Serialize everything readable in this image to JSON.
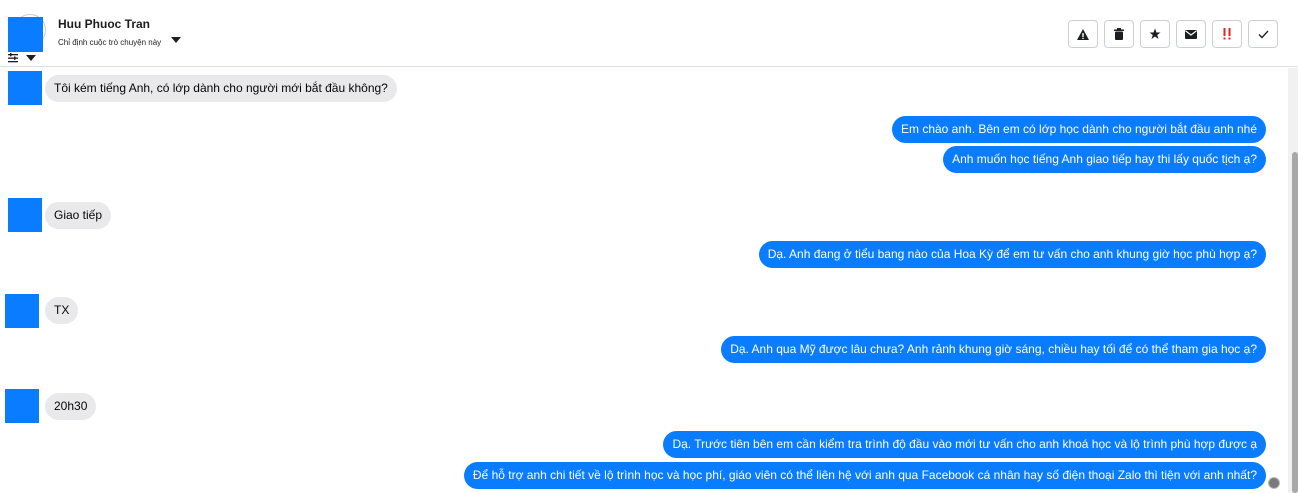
{
  "header": {
    "contact_name": "Huu Phuoc Tran",
    "assign_label": "Chỉ định cuộc trò chuyện này",
    "actions": [
      {
        "icon": "warning-icon"
      },
      {
        "icon": "trash-icon"
      },
      {
        "icon": "star-icon"
      },
      {
        "icon": "envelope-icon"
      },
      {
        "icon": "spam-icon",
        "color": "#e02424"
      },
      {
        "icon": "check-icon"
      }
    ]
  },
  "messages": [
    {
      "side": "in",
      "text": "Tôi kém tiếng Anh, có lớp dành cho người mới bắt đầu không?"
    },
    {
      "side": "out",
      "text": "Em chào anh. Bên em có lớp học dành cho người bắt đầu anh nhé"
    },
    {
      "side": "out",
      "text": "Anh muốn học tiếng Anh giao tiếp hay thi lấy quốc tịch ạ?"
    },
    {
      "side": "in",
      "text": "Giao tiếp"
    },
    {
      "side": "out",
      "text": "Dạ. Anh đang ở tiểu bang nào của Hoa Kỳ để em tư vấn cho anh khung giờ học phù hợp ạ?"
    },
    {
      "side": "in",
      "text": "TX"
    },
    {
      "side": "out",
      "text": "Dạ. Anh qua Mỹ được lâu chưa? Anh rảnh khung giờ sáng, chiều hay tối để có thể tham gia học ạ?"
    },
    {
      "side": "in",
      "text": "20h30"
    },
    {
      "side": "out",
      "text": "Dạ. Trước tiên bên em cần kiểm tra trình độ đầu vào mới tư vấn cho anh khoá học và lộ trình phù hợp được ạ"
    },
    {
      "side": "out",
      "text": "Để hỗ trợ anh chi tiết về lộ trình học và học phí, giáo viên có thể liên hệ với anh qua Facebook cá nhân hay số điện thoại Zalo thì tiện với anh nhất?"
    }
  ],
  "colors": {
    "accent": "#0a7cff",
    "incoming_bubble": "#e9e9eb"
  }
}
